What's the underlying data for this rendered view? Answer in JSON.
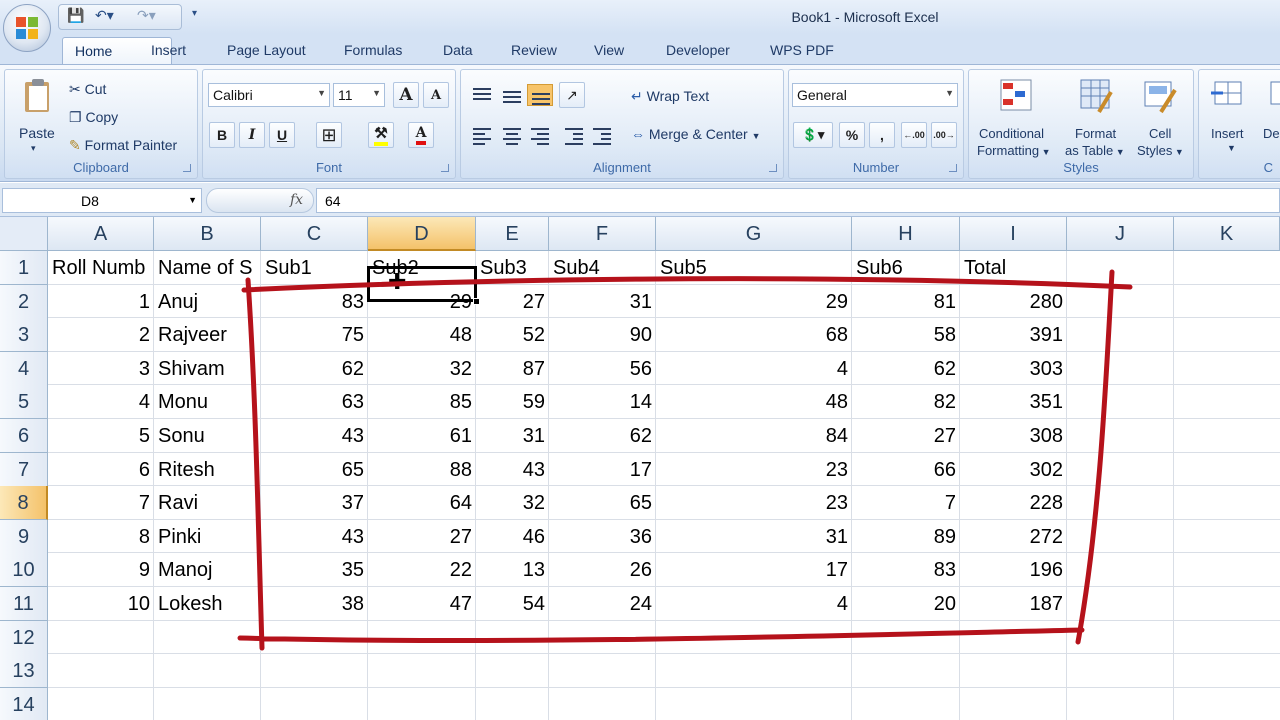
{
  "window": {
    "title": "Book1 - Microsoft Excel"
  },
  "tabs": [
    {
      "label": "Home",
      "active": true
    },
    {
      "label": "Insert"
    },
    {
      "label": "Page Layout"
    },
    {
      "label": "Formulas"
    },
    {
      "label": "Data"
    },
    {
      "label": "Review"
    },
    {
      "label": "View"
    },
    {
      "label": "Developer"
    },
    {
      "label": "WPS PDF"
    }
  ],
  "ribbon": {
    "clipboard": {
      "label": "Clipboard",
      "paste": "Paste",
      "cut": "Cut",
      "copy": "Copy",
      "format_painter": "Format Painter"
    },
    "font": {
      "label": "Font",
      "name": "Calibri",
      "size": "11",
      "bold": "B",
      "italic": "I",
      "underline": "U",
      "grow": "A",
      "shrink": "A",
      "font_color": "A"
    },
    "alignment": {
      "label": "Alignment",
      "wrap_text": "Wrap Text",
      "merge_center": "Merge & Center"
    },
    "number": {
      "label": "Number",
      "format": "General",
      "percent": "%",
      "comma": ","
    },
    "styles": {
      "label": "Styles",
      "conditional": "Conditional",
      "conditional2": "Formatting",
      "format_table": "Format",
      "format_table2": "as Table",
      "cell_styles": "Cell",
      "cell_styles2": "Styles"
    },
    "cells": {
      "insert": "Insert",
      "delete": "De",
      "label": "C"
    }
  },
  "formula_bar": {
    "name_box": "D8",
    "fx": "fx",
    "value": "64"
  },
  "columns": [
    "A",
    "B",
    "C",
    "D",
    "E",
    "F",
    "G",
    "H",
    "I",
    "J",
    "K"
  ],
  "rows": [
    "1",
    "2",
    "3",
    "4",
    "5",
    "6",
    "7",
    "8",
    "9",
    "10",
    "11",
    "12",
    "13",
    "14"
  ],
  "selected": {
    "column": "D",
    "row": "8"
  },
  "sheet": {
    "headers": [
      "Roll Numb",
      "Name of S",
      "Sub1",
      "Sub2",
      "Sub3",
      "Sub4",
      "Sub5",
      "Sub6",
      "Total"
    ],
    "records": [
      [
        "1",
        "Anuj",
        "83",
        "29",
        "27",
        "31",
        "29",
        "81",
        "280"
      ],
      [
        "2",
        "Rajveer",
        "75",
        "48",
        "52",
        "90",
        "68",
        "58",
        "391"
      ],
      [
        "3",
        "Shivam",
        "62",
        "32",
        "87",
        "56",
        "4",
        "62",
        "303"
      ],
      [
        "4",
        "Monu",
        "63",
        "85",
        "59",
        "14",
        "48",
        "82",
        "351"
      ],
      [
        "5",
        "Sonu",
        "43",
        "61",
        "31",
        "62",
        "84",
        "27",
        "308"
      ],
      [
        "6",
        "Ritesh",
        "65",
        "88",
        "43",
        "17",
        "23",
        "66",
        "302"
      ],
      [
        "7",
        "Ravi",
        "37",
        "64",
        "32",
        "65",
        "23",
        "7",
        "228"
      ],
      [
        "8",
        "Pinki",
        "43",
        "27",
        "46",
        "36",
        "31",
        "89",
        "272"
      ],
      [
        "9",
        "Manoj",
        "35",
        "22",
        "13",
        "26",
        "17",
        "83",
        "196"
      ],
      [
        "10",
        "Lokesh",
        "38",
        "47",
        "54",
        "24",
        "4",
        "20",
        "187"
      ]
    ]
  },
  "annotation_color": "#b5121b"
}
